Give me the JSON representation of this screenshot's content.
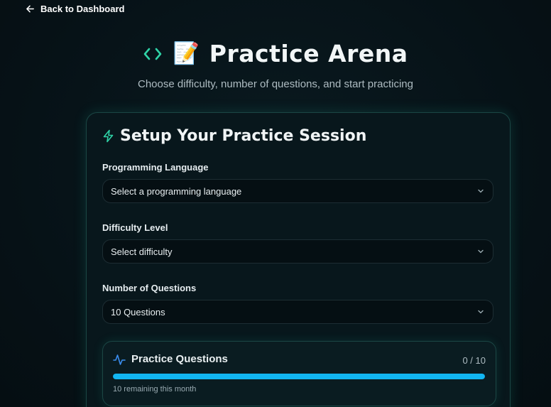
{
  "nav": {
    "back_label": "Back to Dashboard"
  },
  "hero": {
    "emoji": "📝",
    "title": "Practice Arena",
    "subtitle": "Choose difficulty, number of questions, and start practicing"
  },
  "setup": {
    "title": "Setup Your Practice Session",
    "language": {
      "label": "Programming Language",
      "value": "Select a programming language"
    },
    "difficulty": {
      "label": "Difficulty Level",
      "value": "Select difficulty"
    },
    "questions": {
      "label": "Number of Questions",
      "value": "10 Questions"
    }
  },
  "quota": {
    "title": "Practice Questions",
    "count": "0 / 10",
    "remaining_fraction": 1.0,
    "note": "10 remaining this month"
  },
  "colors": {
    "accent_teal": "#2fd3a7",
    "progress_blue": "#12b6f2",
    "pulse_blue": "#3b8ef0",
    "background": "#071419"
  },
  "icons": {
    "back": "arrow-left-icon",
    "code": "code-brackets-icon",
    "setup": "lightning-bolt-icon",
    "select": "chevron-down-icon",
    "quota": "activity-pulse-icon"
  }
}
